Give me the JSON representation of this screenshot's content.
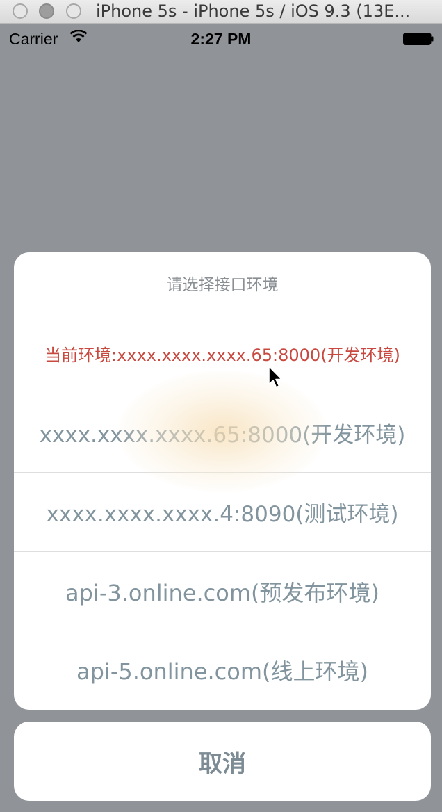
{
  "window": {
    "title": "iPhone 5s - iPhone 5s / iOS 9.3 (13E..."
  },
  "status_bar": {
    "carrier": "Carrier",
    "time": "2:27 PM",
    "wifi_icon": "wifi-icon",
    "battery_icon": "battery-icon"
  },
  "action_sheet": {
    "title": "请选择接口环境",
    "current": "当前环境:xxxx.xxxx.xxxx.65:8000(开发环境)",
    "options": [
      "xxxx.xxxx.xxxx.65:8000(开发环境)",
      "xxxx.xxxx.xxxx.4:8090(测试环境)",
      "api-3.online.com(预发布环境)",
      "api-5.online.com(线上环境)"
    ],
    "cancel": "取消"
  },
  "colors": {
    "overlay": "#909499",
    "current_text": "#c8493f",
    "option_text": "#82949e",
    "title_text": "#8a8f94"
  }
}
